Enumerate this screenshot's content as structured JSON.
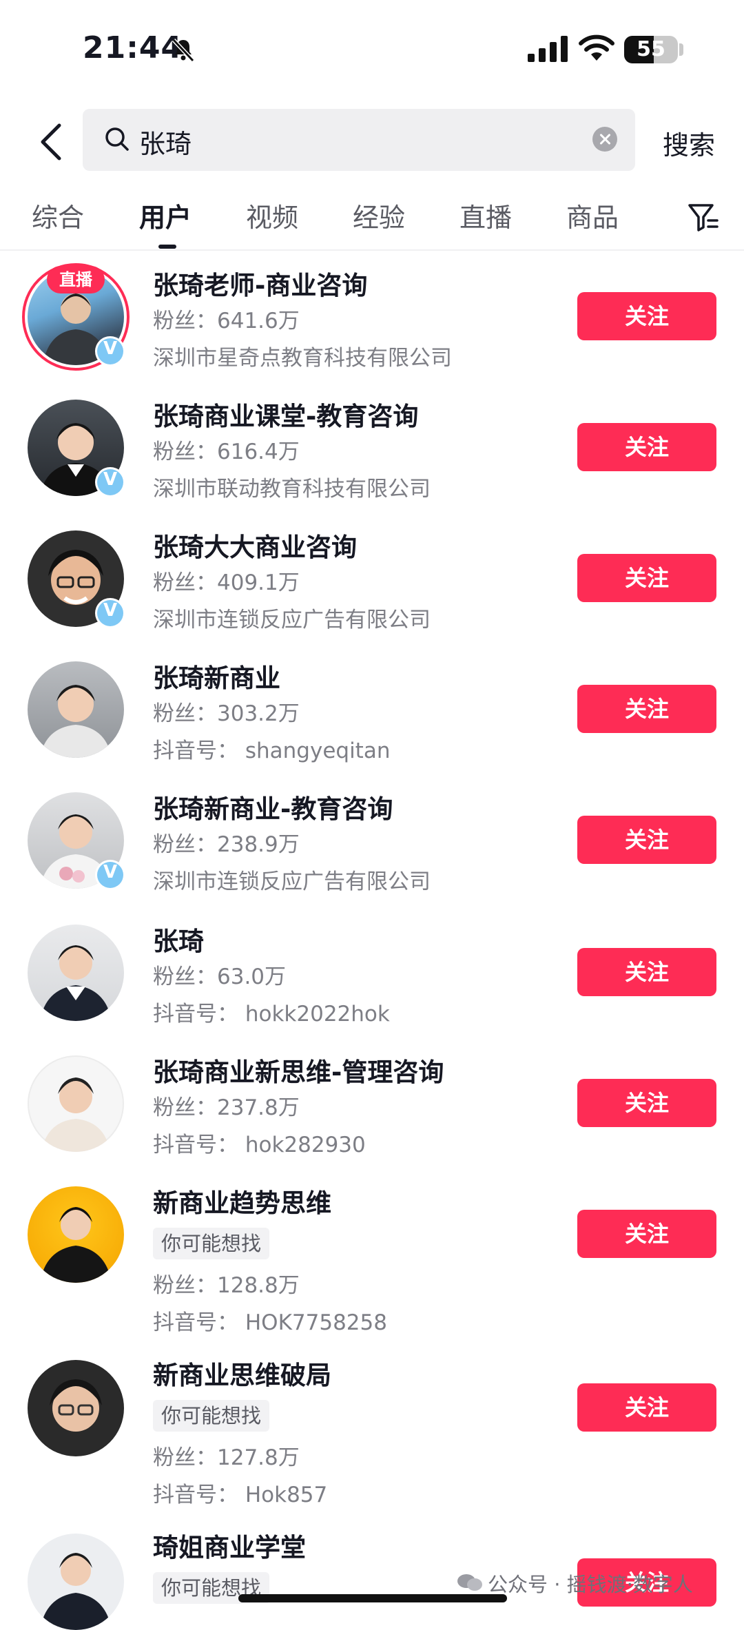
{
  "status_bar": {
    "time": "21:44",
    "battery": "55",
    "battery_level": 0.55
  },
  "search": {
    "query": "张琦",
    "submit_label": "搜索"
  },
  "tabs": [
    {
      "label": "综合"
    },
    {
      "label": "用户",
      "active": true
    },
    {
      "label": "视频"
    },
    {
      "label": "经验"
    },
    {
      "label": "直播"
    },
    {
      "label": "商品"
    }
  ],
  "colors": {
    "accent": "#fe2c55",
    "verified": "#7ec8f5"
  },
  "results": [
    {
      "name": "张琦老师-商业咨询",
      "live_badge": "直播",
      "verified": true,
      "fans": "粉丝：641.6万",
      "detail": "深圳市星奇点教育科技有限公司",
      "follow": "关注"
    },
    {
      "name": "张琦商业课堂-教育咨询",
      "verified": true,
      "fans": "粉丝：616.4万",
      "detail": "深圳市联动教育科技有限公司",
      "follow": "关注"
    },
    {
      "name": "张琦大大商业咨询",
      "verified": true,
      "fans": "粉丝：409.1万",
      "detail": "深圳市连锁反应广告有限公司",
      "follow": "关注"
    },
    {
      "name": "张琦新商业",
      "verified": false,
      "fans": "粉丝：303.2万",
      "detail": "抖音号：  shangyeqitan",
      "follow": "关注"
    },
    {
      "name": "张琦新商业-教育咨询",
      "verified": true,
      "fans": "粉丝：238.9万",
      "detail": "深圳市连锁反应广告有限公司",
      "follow": "关注"
    },
    {
      "name": "张琦",
      "verified": false,
      "fans": "粉丝：63.0万",
      "detail": "抖音号：  hokk2022hok",
      "follow": "关注"
    },
    {
      "name": "张琦商业新思维-管理咨询",
      "verified": false,
      "fans": "粉丝：237.8万",
      "detail": "抖音号：  hok282930",
      "follow": "关注"
    },
    {
      "name": "新商业趋势思维",
      "verified": false,
      "tag": "你可能想找",
      "fans": "粉丝：128.8万",
      "detail": "抖音号：  HOK7758258",
      "follow": "关注"
    },
    {
      "name": "新商业思维破局",
      "verified": false,
      "tag": "你可能想找",
      "fans": "粉丝：127.8万",
      "detail": "抖音号：  Hok857",
      "follow": "关注"
    },
    {
      "name": "琦姐商业学堂",
      "verified": false,
      "tag": "你可能想找",
      "follow": "关注"
    }
  ],
  "watermark": "公众号 · 摇钱渡·数字人"
}
